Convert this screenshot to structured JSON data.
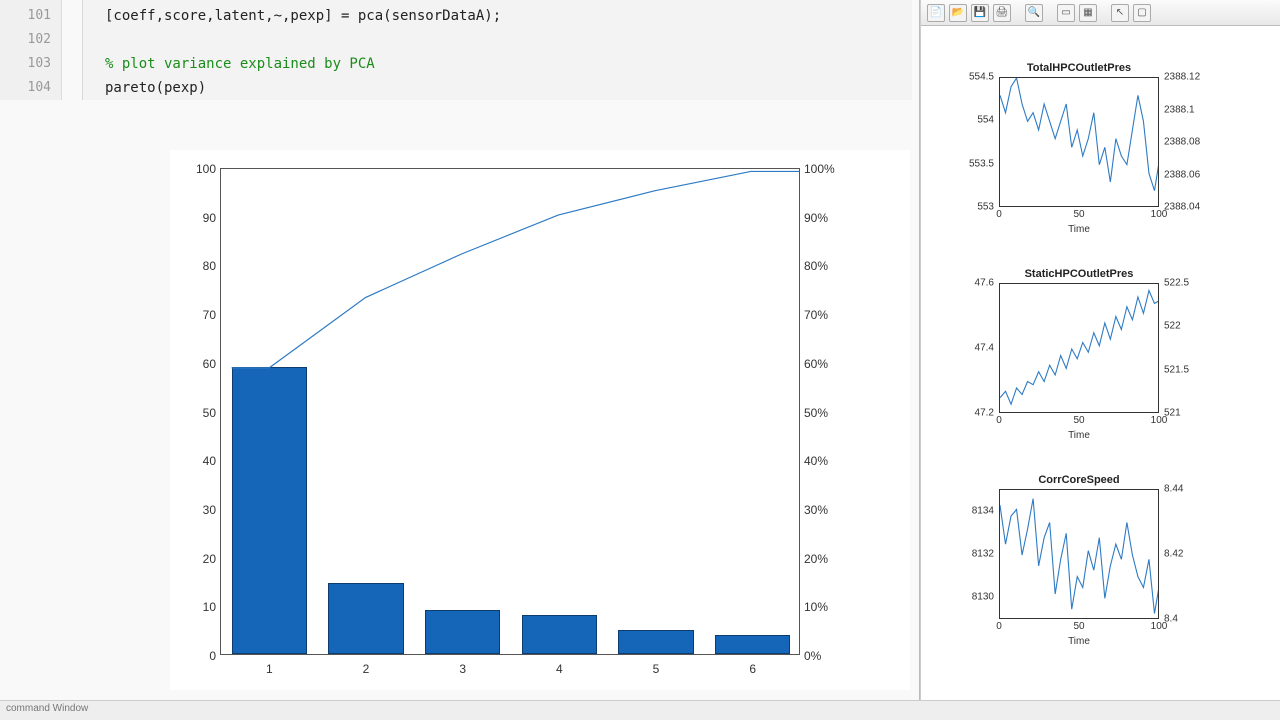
{
  "editor": {
    "lines": [
      {
        "num": "101",
        "code": "[coeff,score,latent,~,pexp] = pca(sensorDataA);",
        "style": "code"
      },
      {
        "num": "102",
        "code": "",
        "style": "code"
      },
      {
        "num": "103",
        "code": "% plot variance explained by PCA",
        "style": "comment"
      },
      {
        "num": "104",
        "code": "pareto(pexp)",
        "style": "code"
      }
    ]
  },
  "chart_data": {
    "type": "bar",
    "categories": [
      "1",
      "2",
      "3",
      "4",
      "5",
      "6"
    ],
    "values": [
      59,
      14.5,
      9,
      8,
      5,
      4
    ],
    "cum_pct": [
      59,
      73.5,
      82.5,
      90.5,
      95.5,
      99.5
    ],
    "ylim": [
      0,
      100
    ],
    "y2lim": [
      0,
      100
    ],
    "y_ticks": [
      0,
      10,
      20,
      30,
      40,
      50,
      60,
      70,
      80,
      90,
      100
    ],
    "y2_ticks": [
      "0%",
      "10%",
      "20%",
      "30%",
      "40%",
      "50%",
      "60%",
      "70%",
      "80%",
      "90%",
      "100%"
    ],
    "title": "",
    "xlabel": "",
    "ylabel": ""
  },
  "mini": [
    {
      "title": "TotalHPCOutletPres",
      "xlabel": "Time",
      "x_ticks": [
        "0",
        "50",
        "100"
      ],
      "y_ticks": [
        "553",
        "553.5",
        "554",
        "554.5"
      ],
      "y_range": [
        553,
        554.5
      ],
      "y2_ticks": [
        "2388.04",
        "2388.06",
        "2388.08",
        "2388.1",
        "2388.12"
      ],
      "series": [
        554.3,
        554.1,
        554.4,
        554.5,
        554.2,
        554.0,
        554.1,
        553.9,
        554.2,
        554.0,
        553.8,
        554.0,
        554.2,
        553.7,
        553.9,
        553.6,
        553.8,
        554.1,
        553.5,
        553.7,
        553.3,
        553.8,
        553.6,
        553.5,
        553.9,
        554.3,
        554.0,
        553.4,
        553.2,
        553.6
      ]
    },
    {
      "title": "StaticHPCOutletPres",
      "xlabel": "Time",
      "x_ticks": [
        "0",
        "50",
        "100"
      ],
      "y_ticks": [
        "47.2",
        "47.4",
        "47.6"
      ],
      "y_range": [
        47.2,
        47.6
      ],
      "y2_ticks": [
        "521",
        "521.5",
        "522",
        "522.5"
      ],
      "series": [
        47.25,
        47.27,
        47.23,
        47.28,
        47.26,
        47.3,
        47.29,
        47.33,
        47.3,
        47.35,
        47.32,
        47.38,
        47.34,
        47.4,
        47.37,
        47.42,
        47.39,
        47.45,
        47.41,
        47.48,
        47.43,
        47.5,
        47.46,
        47.53,
        47.49,
        47.56,
        47.51,
        47.58,
        47.54,
        47.55
      ]
    },
    {
      "title": "CorrCoreSpeed",
      "xlabel": "Time",
      "x_ticks": [
        "0",
        "50",
        "100"
      ],
      "y_ticks": [
        "8130",
        "8132",
        "8134"
      ],
      "y_range": [
        8129,
        8135
      ],
      "y2_ticks": [
        "8.4",
        "8.42",
        "8.44"
      ],
      "series": [
        8134.3,
        8132.5,
        8133.8,
        8134.1,
        8132.0,
        8133.2,
        8134.6,
        8131.5,
        8132.8,
        8133.5,
        8130.2,
        8131.8,
        8133.0,
        8129.5,
        8131.0,
        8130.5,
        8132.2,
        8131.3,
        8132.8,
        8130.0,
        8131.5,
        8132.5,
        8131.8,
        8133.5,
        8132.0,
        8131.0,
        8130.5,
        8131.8,
        8129.3,
        8130.8
      ]
    }
  ],
  "toolbar_icons": [
    "new-icon",
    "open-icon",
    "save-icon",
    "print-icon",
    "zoom-icon",
    "link-icon",
    "rotate-icon",
    "cursor-icon",
    "datacursor-icon"
  ],
  "status": "command Window"
}
